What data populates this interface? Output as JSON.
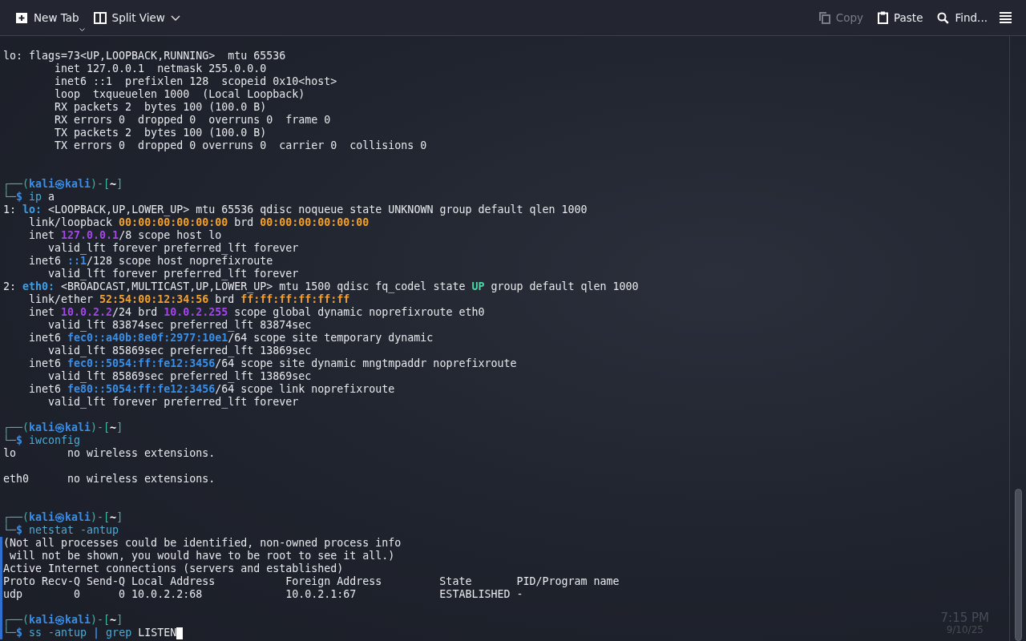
{
  "toolbar": {
    "left": [
      {
        "kind": "new-tab",
        "label": "New Tab",
        "dropdown": true
      },
      {
        "kind": "split-view",
        "label": "Split View",
        "dropdown": true
      }
    ],
    "right": [
      {
        "kind": "copy",
        "label": "Copy",
        "disabled": true
      },
      {
        "kind": "paste",
        "label": "Paste",
        "disabled": false
      },
      {
        "kind": "find",
        "label": "Find...",
        "disabled": false
      },
      {
        "kind": "menu"
      }
    ]
  },
  "terminal": {
    "lines": [
      {
        "kind": "text",
        "segments": [
          {
            "kind": "plain",
            "text": "lo: flags=73<UP,LOOPBACK,RUNNING>  mtu 65536"
          }
        ]
      },
      {
        "kind": "text",
        "segments": [
          {
            "kind": "plain",
            "text": "        inet 127.0.0.1  netmask 255.0.0.0"
          }
        ]
      },
      {
        "kind": "text",
        "segments": [
          {
            "kind": "plain",
            "text": "        inet6 ::1  prefixlen 128  scopeid 0x10<host>"
          }
        ]
      },
      {
        "kind": "text",
        "segments": [
          {
            "kind": "plain",
            "text": "        loop  txqueuelen 1000  (Local Loopback)"
          }
        ]
      },
      {
        "kind": "text",
        "segments": [
          {
            "kind": "plain",
            "text": "        RX packets 2  bytes 100 (100.0 B)"
          }
        ]
      },
      {
        "kind": "text",
        "segments": [
          {
            "kind": "plain",
            "text": "        RX errors 0  dropped 0  overruns 0  frame 0"
          }
        ]
      },
      {
        "kind": "text",
        "segments": [
          {
            "kind": "plain",
            "text": "        TX packets 2  bytes 100 (100.0 B)"
          }
        ]
      },
      {
        "kind": "text",
        "segments": [
          {
            "kind": "plain",
            "text": "        TX errors 0  dropped 0 overruns 0  carrier 0  collisions 0"
          }
        ]
      },
      {
        "kind": "blank"
      },
      {
        "kind": "blank"
      },
      {
        "kind": "text",
        "segments": [
          {
            "kind": "frame",
            "text": "┌──("
          },
          {
            "kind": "user",
            "text": "kali㉿kali"
          },
          {
            "kind": "frame",
            "text": ")-["
          },
          {
            "kind": "path",
            "text": "~"
          },
          {
            "kind": "frame",
            "text": "]"
          }
        ]
      },
      {
        "kind": "text",
        "segments": [
          {
            "kind": "frame",
            "text": "└─"
          },
          {
            "kind": "dollar",
            "text": "$ "
          },
          {
            "kind": "command",
            "text": "ip"
          },
          {
            "kind": "plain",
            "text": " a"
          }
        ]
      },
      {
        "kind": "text",
        "segments": [
          {
            "kind": "plain",
            "text": "1: "
          },
          {
            "kind": "iface",
            "text": "lo:"
          },
          {
            "kind": "plain",
            "text": " <LOOPBACK,UP,LOWER_UP> mtu 65536 qdisc noqueue state UNKNOWN group default qlen 1000"
          }
        ]
      },
      {
        "kind": "text",
        "segments": [
          {
            "kind": "plain",
            "text": "    link/loopback "
          },
          {
            "kind": "mac",
            "text": "00:00:00:00:00:00"
          },
          {
            "kind": "plain",
            "text": " brd "
          },
          {
            "kind": "mac",
            "text": "00:00:00:00:00:00"
          }
        ]
      },
      {
        "kind": "text",
        "segments": [
          {
            "kind": "plain",
            "text": "    inet "
          },
          {
            "kind": "ipv4",
            "text": "127.0.0.1"
          },
          {
            "kind": "plain",
            "text": "/8 scope host lo"
          }
        ]
      },
      {
        "kind": "text",
        "segments": [
          {
            "kind": "plain",
            "text": "       valid_lft forever preferred_lft forever"
          }
        ]
      },
      {
        "kind": "text",
        "segments": [
          {
            "kind": "plain",
            "text": "    inet6 "
          },
          {
            "kind": "ipv6",
            "text": "::1"
          },
          {
            "kind": "plain",
            "text": "/128 scope host noprefixroute"
          }
        ]
      },
      {
        "kind": "text",
        "segments": [
          {
            "kind": "plain",
            "text": "       valid_lft forever preferred_lft forever"
          }
        ]
      },
      {
        "kind": "text",
        "segments": [
          {
            "kind": "plain",
            "text": "2: "
          },
          {
            "kind": "iface",
            "text": "eth0:"
          },
          {
            "kind": "plain",
            "text": " <BROADCAST,MULTICAST,UP,LOWER_UP> mtu 1500 qdisc fq_codel state "
          },
          {
            "kind": "up",
            "text": "UP"
          },
          {
            "kind": "plain",
            "text": " group default qlen 1000"
          }
        ]
      },
      {
        "kind": "text",
        "segments": [
          {
            "kind": "plain",
            "text": "    link/ether "
          },
          {
            "kind": "mac",
            "text": "52:54:00:12:34:56"
          },
          {
            "kind": "plain",
            "text": " brd "
          },
          {
            "kind": "mac",
            "text": "ff:ff:ff:ff:ff:ff"
          }
        ]
      },
      {
        "kind": "text",
        "segments": [
          {
            "kind": "plain",
            "text": "    inet "
          },
          {
            "kind": "ipv4",
            "text": "10.0.2.2"
          },
          {
            "kind": "plain",
            "text": "/24 brd "
          },
          {
            "kind": "ipv4",
            "text": "10.0.2.255"
          },
          {
            "kind": "plain",
            "text": " scope global dynamic noprefixroute eth0"
          }
        ]
      },
      {
        "kind": "text",
        "segments": [
          {
            "kind": "plain",
            "text": "       valid_lft 83874sec preferred_lft 83874sec"
          }
        ]
      },
      {
        "kind": "text",
        "segments": [
          {
            "kind": "plain",
            "text": "    inet6 "
          },
          {
            "kind": "ipv6",
            "text": "fec0::a40b:8e0f:2977:10e1"
          },
          {
            "kind": "plain",
            "text": "/64 scope site temporary dynamic"
          }
        ]
      },
      {
        "kind": "text",
        "segments": [
          {
            "kind": "plain",
            "text": "       valid_lft 85869sec preferred_lft 13869sec"
          }
        ]
      },
      {
        "kind": "text",
        "segments": [
          {
            "kind": "plain",
            "text": "    inet6 "
          },
          {
            "kind": "ipv6",
            "text": "fec0::5054:ff:fe12:3456"
          },
          {
            "kind": "plain",
            "text": "/64 scope site dynamic mngtmpaddr noprefixroute"
          }
        ]
      },
      {
        "kind": "text",
        "segments": [
          {
            "kind": "plain",
            "text": "       valid_lft 85869sec preferred_lft 13869sec"
          }
        ]
      },
      {
        "kind": "text",
        "segments": [
          {
            "kind": "plain",
            "text": "    inet6 "
          },
          {
            "kind": "ipv6",
            "text": "fe80::5054:ff:fe12:3456"
          },
          {
            "kind": "plain",
            "text": "/64 scope link noprefixroute"
          }
        ]
      },
      {
        "kind": "text",
        "segments": [
          {
            "kind": "plain",
            "text": "       valid_lft forever preferred_lft forever"
          }
        ]
      },
      {
        "kind": "blank"
      },
      {
        "kind": "text",
        "segments": [
          {
            "kind": "frame",
            "text": "┌──("
          },
          {
            "kind": "user",
            "text": "kali㉿kali"
          },
          {
            "kind": "frame",
            "text": ")-["
          },
          {
            "kind": "path",
            "text": "~"
          },
          {
            "kind": "frame",
            "text": "]"
          }
        ]
      },
      {
        "kind": "text",
        "segments": [
          {
            "kind": "frame",
            "text": "└─"
          },
          {
            "kind": "dollar",
            "text": "$ "
          },
          {
            "kind": "command",
            "text": "iwconfig"
          }
        ]
      },
      {
        "kind": "text",
        "segments": [
          {
            "kind": "plain",
            "text": "lo        no wireless extensions."
          }
        ]
      },
      {
        "kind": "blank"
      },
      {
        "kind": "text",
        "segments": [
          {
            "kind": "plain",
            "text": "eth0      no wireless extensions."
          }
        ]
      },
      {
        "kind": "blank"
      },
      {
        "kind": "blank"
      },
      {
        "kind": "text",
        "segments": [
          {
            "kind": "frame",
            "text": "┌──("
          },
          {
            "kind": "user",
            "text": "kali㉿kali"
          },
          {
            "kind": "frame",
            "text": ")-["
          },
          {
            "kind": "path",
            "text": "~"
          },
          {
            "kind": "frame",
            "text": "]"
          }
        ]
      },
      {
        "kind": "text",
        "segments": [
          {
            "kind": "frame",
            "text": "└─"
          },
          {
            "kind": "dollar",
            "text": "$ "
          },
          {
            "kind": "command",
            "text": "netstat"
          },
          {
            "kind": "command",
            "text": " -antup"
          }
        ]
      },
      {
        "kind": "text",
        "marked": true,
        "segments": [
          {
            "kind": "plain",
            "text": "(Not all processes could be identified, non-owned process info"
          }
        ]
      },
      {
        "kind": "text",
        "marked": true,
        "segments": [
          {
            "kind": "plain",
            "text": " will not be shown, you would have to be root to see it all.)"
          }
        ]
      },
      {
        "kind": "text",
        "marked": true,
        "segments": [
          {
            "kind": "plain",
            "text": "Active Internet connections (servers and established)"
          }
        ]
      },
      {
        "kind": "text",
        "marked": true,
        "segments": [
          {
            "kind": "plain",
            "text": "Proto Recv-Q Send-Q Local Address           Foreign Address         State       PID/Program name"
          }
        ]
      },
      {
        "kind": "text",
        "marked": true,
        "segments": [
          {
            "kind": "plain",
            "text": "udp        0      0 10.0.2.2:68             10.0.2.1:67             ESTABLISHED -"
          }
        ]
      },
      {
        "kind": "blank",
        "marked": true
      },
      {
        "kind": "text",
        "marked": true,
        "segments": [
          {
            "kind": "frame",
            "text": "┌──("
          },
          {
            "kind": "user",
            "text": "kali㉿kali"
          },
          {
            "kind": "frame",
            "text": ")-["
          },
          {
            "kind": "path",
            "text": "~"
          },
          {
            "kind": "frame",
            "text": "]"
          }
        ]
      },
      {
        "kind": "text",
        "marked": true,
        "cursor": true,
        "segments": [
          {
            "kind": "frame",
            "text": "└─"
          },
          {
            "kind": "dollar",
            "text": "$ "
          },
          {
            "kind": "command",
            "text": "ss"
          },
          {
            "kind": "command",
            "text": " -antup "
          },
          {
            "kind": "pipe",
            "text": "|"
          },
          {
            "kind": "command",
            "text": " grep"
          },
          {
            "kind": "plain",
            "text": " LISTEN"
          }
        ]
      }
    ]
  },
  "background_taskbar": {
    "time": "7:15 PM",
    "date": "9/10/25"
  }
}
